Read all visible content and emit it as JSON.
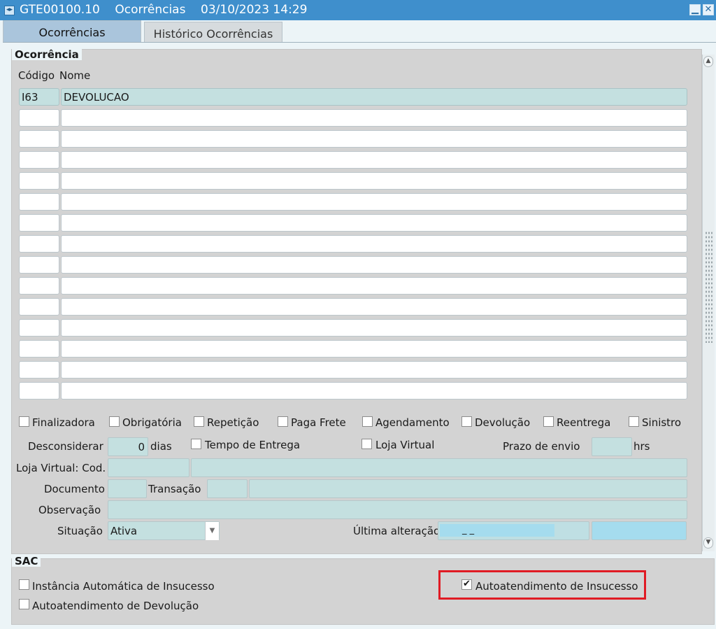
{
  "window": {
    "app_icon": "app-form-icon",
    "title": "GTE00100.10    Ocorrências    03/10/2023 14:29",
    "minimize_icon": "minimize-icon",
    "close_icon": "close-icon"
  },
  "tabs": [
    {
      "label": "Ocorrências",
      "active": true
    },
    {
      "label": "Histórico Ocorrências",
      "active": false
    }
  ],
  "ocorrencia": {
    "group_title": "Ocorrência",
    "col_codigo": "Código",
    "col_nome": "Nome",
    "rows": [
      {
        "codigo": "I63",
        "nome": "DEVOLUCAO"
      },
      {
        "codigo": "",
        "nome": ""
      },
      {
        "codigo": "",
        "nome": ""
      },
      {
        "codigo": "",
        "nome": ""
      },
      {
        "codigo": "",
        "nome": ""
      },
      {
        "codigo": "",
        "nome": ""
      },
      {
        "codigo": "",
        "nome": ""
      },
      {
        "codigo": "",
        "nome": ""
      },
      {
        "codigo": "",
        "nome": ""
      },
      {
        "codigo": "",
        "nome": ""
      },
      {
        "codigo": "",
        "nome": ""
      },
      {
        "codigo": "",
        "nome": ""
      },
      {
        "codigo": "",
        "nome": ""
      },
      {
        "codigo": "",
        "nome": ""
      },
      {
        "codigo": "",
        "nome": ""
      }
    ]
  },
  "flags": [
    {
      "label": "Finalizadora",
      "checked": false
    },
    {
      "label": "Obrigatória",
      "checked": false
    },
    {
      "label": "Repetição",
      "checked": false
    },
    {
      "label": "Paga Frete",
      "checked": false
    },
    {
      "label": "Agendamento",
      "checked": false
    },
    {
      "label": "Devolução",
      "checked": false
    },
    {
      "label": "Reentrega",
      "checked": false
    },
    {
      "label": "Sinistro",
      "checked": false
    }
  ],
  "desconsiderar": {
    "label": "Desconsiderar",
    "value": "0",
    "unit": "dias"
  },
  "tempo_entrega": {
    "label": "Tempo de Entrega",
    "checked": false
  },
  "loja_virtual": {
    "label": "Loja Virtual",
    "checked": false
  },
  "prazo_envio": {
    "label": "Prazo de envio",
    "value": "",
    "unit": "hrs"
  },
  "loja_virtual_cod": {
    "label": "Loja Virtual: Cod.",
    "code": "",
    "name": ""
  },
  "documento": {
    "label": "Documento",
    "value": ""
  },
  "transacao": {
    "label": "Transação",
    "code": "",
    "name": ""
  },
  "observacao": {
    "label": "Observação",
    "value": ""
  },
  "situacao": {
    "label": "Situação",
    "value": "Ativa",
    "dropdown_icon": "chevron-down-icon"
  },
  "ultima_alteracao": {
    "label": "Última alteração",
    "user": "_  _",
    "date": ""
  },
  "sac": {
    "group_title": "SAC",
    "instancia": {
      "label": "Instância Automática de Insucesso",
      "checked": false
    },
    "autoatendimento_devolucao": {
      "label": "Autoatendimento de Devolução",
      "checked": false
    },
    "autoatendimento_insucesso": {
      "label": "Autoatendimento de Insucesso",
      "checked": true
    }
  },
  "colors": {
    "titlebar": "#3f8fcc",
    "field_bg": "#c4e0e0",
    "panel_bg": "#d3d3d3",
    "highlight": "#e01b24"
  }
}
